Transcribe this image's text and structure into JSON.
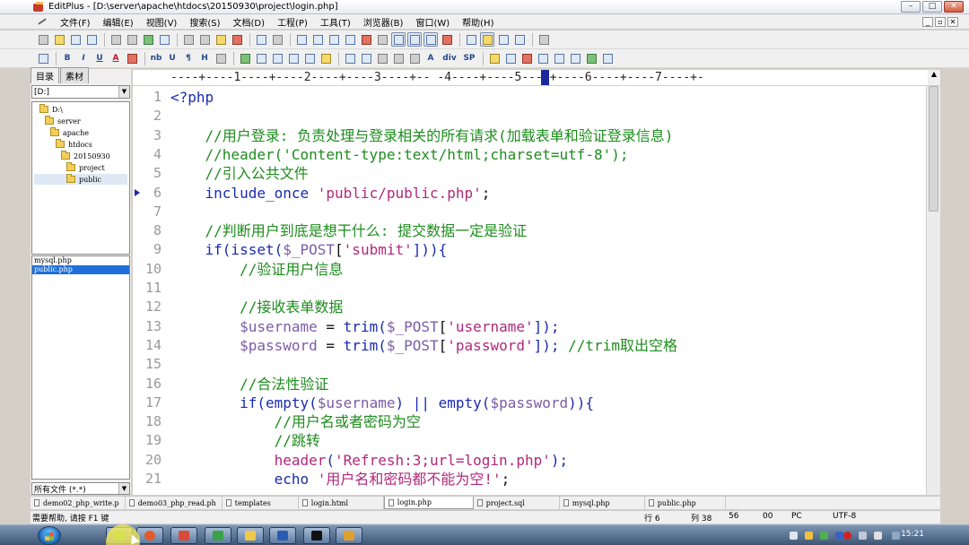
{
  "window": {
    "title": "EditPlus - [D:\\server\\apache\\htdocs\\20150930\\project\\login.php]",
    "buttons": {
      "minimize": "–",
      "maximize": "□",
      "close": "✕"
    }
  },
  "menu": {
    "items": [
      "文件(F)",
      "编辑(E)",
      "视图(V)",
      "搜索(S)",
      "文档(D)",
      "工程(P)",
      "工具(T)",
      "浏览器(B)",
      "窗口(W)",
      "帮助(H)"
    ],
    "mdi": [
      "_",
      "▫",
      "✕"
    ]
  },
  "toolbar2": {
    "labels": [
      "B",
      "I",
      "U",
      "A",
      "nb",
      "U",
      "¶",
      "H",
      "A",
      "div",
      "SP"
    ]
  },
  "left_panel": {
    "tabs": [
      "目录",
      "素材"
    ],
    "drive": "[D:]",
    "tree": [
      "D:\\",
      "server",
      "apache",
      "htdocs",
      "20150930",
      "project",
      "public"
    ],
    "files": [
      "mysql.php",
      "public.php"
    ],
    "filter": "所有文件 (*.*)"
  },
  "editor": {
    "ruler": "----+----1----+----2----+----3----+-- -4----+----5----+----6----+----7----+-",
    "lines": [
      [
        {
          "c": "kw",
          "t": "<?php"
        }
      ],
      [],
      [
        {
          "c": "cm",
          "t": "    //用户登录: 负责处理与登录相关的所有请求(加载表单和验证登录信息)"
        }
      ],
      [
        {
          "c": "cm",
          "t": "    //header('Content-type:text/html;charset=utf-8');"
        }
      ],
      [
        {
          "c": "cm",
          "t": "    //引入公共文件"
        }
      ],
      [
        {
          "c": "kw",
          "t": "    include_once "
        },
        {
          "c": "str",
          "t": "'public/public.php'"
        },
        {
          "c": "op",
          "t": ";"
        }
      ],
      [],
      [
        {
          "c": "cm",
          "t": "    //判断用户到底是想干什么: 提交数据一定是验证"
        }
      ],
      [
        {
          "c": "kw",
          "t": "    if(isset("
        },
        {
          "c": "var",
          "t": "$_POST"
        },
        {
          "c": "op",
          "t": "["
        },
        {
          "c": "str",
          "t": "'submit'"
        },
        {
          "c": "kw",
          "t": "])){"
        }
      ],
      [
        {
          "c": "cm",
          "t": "        //验证用户信息"
        }
      ],
      [],
      [
        {
          "c": "cm",
          "t": "        //接收表单数据"
        }
      ],
      [
        {
          "c": "var",
          "t": "        $username"
        },
        {
          "c": "op",
          "t": " = "
        },
        {
          "c": "kw",
          "t": "trim("
        },
        {
          "c": "var",
          "t": "$_POST"
        },
        {
          "c": "op",
          "t": "["
        },
        {
          "c": "str",
          "t": "'username'"
        },
        {
          "c": "kw",
          "t": "]);"
        }
      ],
      [
        {
          "c": "var",
          "t": "        $password"
        },
        {
          "c": "op",
          "t": " = "
        },
        {
          "c": "kw",
          "t": "trim("
        },
        {
          "c": "var",
          "t": "$_POST"
        },
        {
          "c": "op",
          "t": "["
        },
        {
          "c": "str",
          "t": "'password'"
        },
        {
          "c": "kw",
          "t": "]);"
        },
        {
          "c": "cm",
          "t": " //trim取出空格"
        }
      ],
      [],
      [
        {
          "c": "cm",
          "t": "        //合法性验证"
        }
      ],
      [
        {
          "c": "kw",
          "t": "        if(empty("
        },
        {
          "c": "var",
          "t": "$username"
        },
        {
          "c": "kw",
          "t": ") || empty("
        },
        {
          "c": "var",
          "t": "$password"
        },
        {
          "c": "kw",
          "t": ")){"
        }
      ],
      [
        {
          "c": "cm",
          "t": "            //用户名或者密码为空"
        }
      ],
      [
        {
          "c": "cm",
          "t": "            //跳转"
        }
      ],
      [
        {
          "c": "str",
          "t": "            header"
        },
        {
          "c": "kw",
          "t": "("
        },
        {
          "c": "str",
          "t": "'Refresh:3;url=login.php'"
        },
        {
          "c": "kw",
          "t": ");"
        }
      ],
      [
        {
          "c": "kw",
          "t": "            echo "
        },
        {
          "c": "str",
          "t": "'用户名和密码都不能为空!'"
        },
        {
          "c": "op",
          "t": ";"
        }
      ]
    ],
    "line_numbers": [
      "1",
      "2",
      "3",
      "4",
      "5",
      "6",
      "7",
      "8",
      "9",
      "10",
      "11",
      "12",
      "13",
      "14",
      "15",
      "16",
      "17",
      "18",
      "19",
      "20",
      "21"
    ]
  },
  "file_tabs": [
    "demo02_php_write.p",
    "demo03_php_read.ph",
    "templates",
    "login.html",
    "login.php",
    "project.sql",
    "mysql.php",
    "public.php"
  ],
  "status": {
    "help": "需要帮助, 请按 F1 键",
    "row": "行 6",
    "col": "列 38",
    "n56": "56",
    "n00": "00",
    "pc": "PC",
    "enc": "UTF-8"
  },
  "taskbar": {
    "clock": "15:21"
  }
}
